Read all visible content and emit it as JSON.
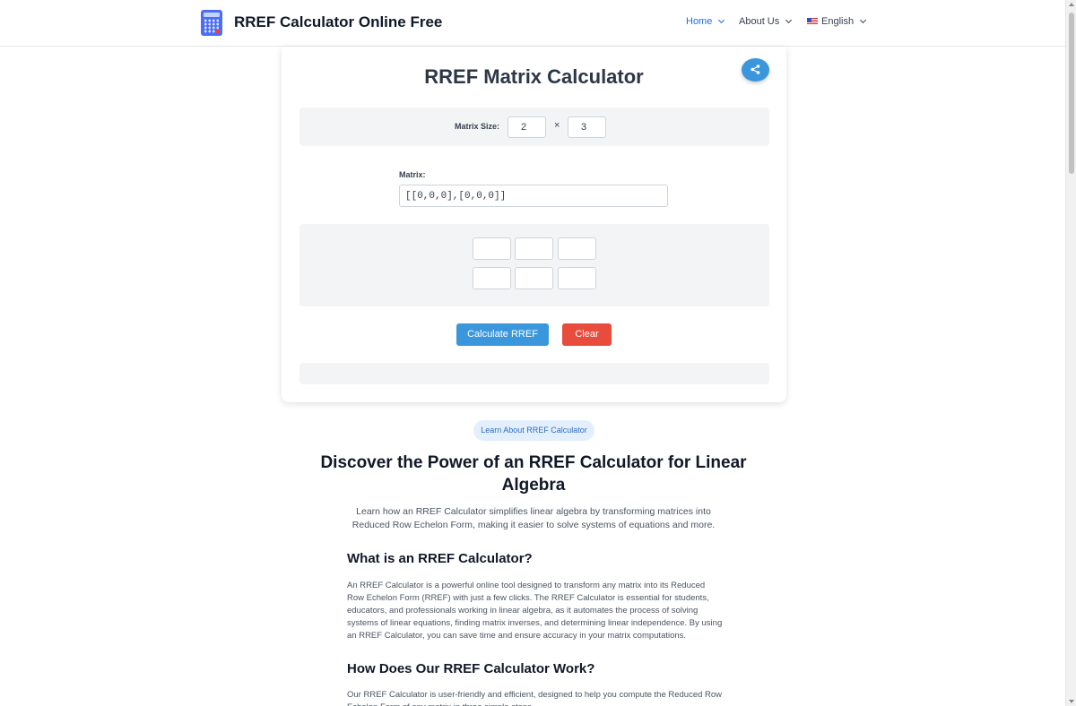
{
  "header": {
    "site_title": "RREF Calculator Online Free",
    "logo_icon": "calculator-icon",
    "nav": [
      {
        "label": "Home",
        "active": true
      },
      {
        "label": "About Us",
        "active": false
      },
      {
        "label": "English",
        "active": false,
        "icon": "us-flag-icon"
      }
    ]
  },
  "calculator": {
    "title": "RREF Matrix Calculator",
    "share_icon": "share-icon",
    "size_label": "Matrix Size:",
    "rows": "2",
    "times_symbol": "×",
    "cols": "3",
    "matrix_label": "Matrix:",
    "matrix_value": "[[0,0,0],[0,0,0]]",
    "cells": [
      [
        "",
        "",
        ""
      ],
      [
        "",
        "",
        ""
      ]
    ],
    "calculate_label": "Calculate RREF",
    "clear_label": "Clear",
    "result": ""
  },
  "article": {
    "pill_label": "Learn About RREF Calculator",
    "title": "Discover the Power of an RREF Calculator for Linear Algebra",
    "lead": "Learn how an RREF Calculator simplifies linear algebra by transforming matrices into Reduced Row Echelon Form, making it easier to solve systems of equations and more.",
    "sections": [
      {
        "heading": "What is an RREF Calculator?",
        "body": "An RREF Calculator is a powerful online tool designed to transform any matrix into its Reduced Row Echelon Form (RREF) with just a few clicks. The RREF Calculator is essential for students, educators, and professionals working in linear algebra, as it automates the process of solving systems of linear equations, finding matrix inverses, and determining linear independence. By using an RREF Calculator, you can save time and ensure accuracy in your matrix computations."
      },
      {
        "heading": "How Does Our RREF Calculator Work?",
        "body": "Our RREF Calculator is user-friendly and efficient, designed to help you compute the Reduced Row Echelon Form of any matrix in three simple steps."
      }
    ]
  },
  "colors": {
    "primary": "#3b97db",
    "danger": "#e74c3c",
    "nav_active": "#1e6fd9",
    "panel_bg": "#f3f4f6"
  }
}
